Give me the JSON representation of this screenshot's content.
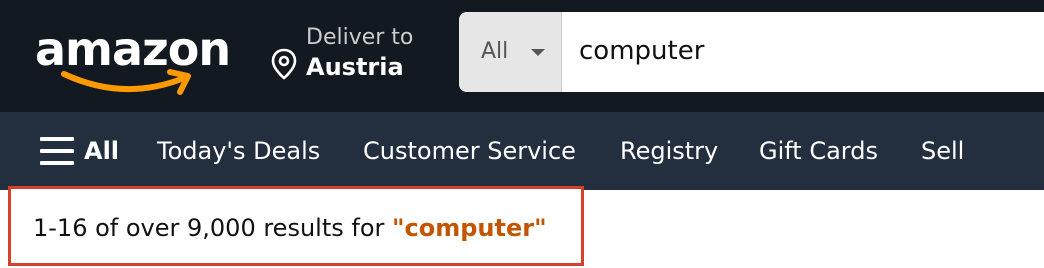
{
  "header": {
    "logo_text": "amazon",
    "deliver_to_label": "Deliver to",
    "deliver_to_location": "Austria",
    "search": {
      "category": "All",
      "query": "computer"
    }
  },
  "nav": {
    "all_label": "All",
    "items": [
      "Today's Deals",
      "Customer Service",
      "Registry",
      "Gift Cards",
      "Sell"
    ]
  },
  "results": {
    "summary": "1-16 of over 9,000 results for",
    "query_quoted": "\"computer\""
  },
  "colors": {
    "topbar_bg": "#131921",
    "navbar_bg": "#232f3e",
    "smile_orange": "#ff9900",
    "query_highlight": "#c45500",
    "box_border": "#d5412b"
  }
}
